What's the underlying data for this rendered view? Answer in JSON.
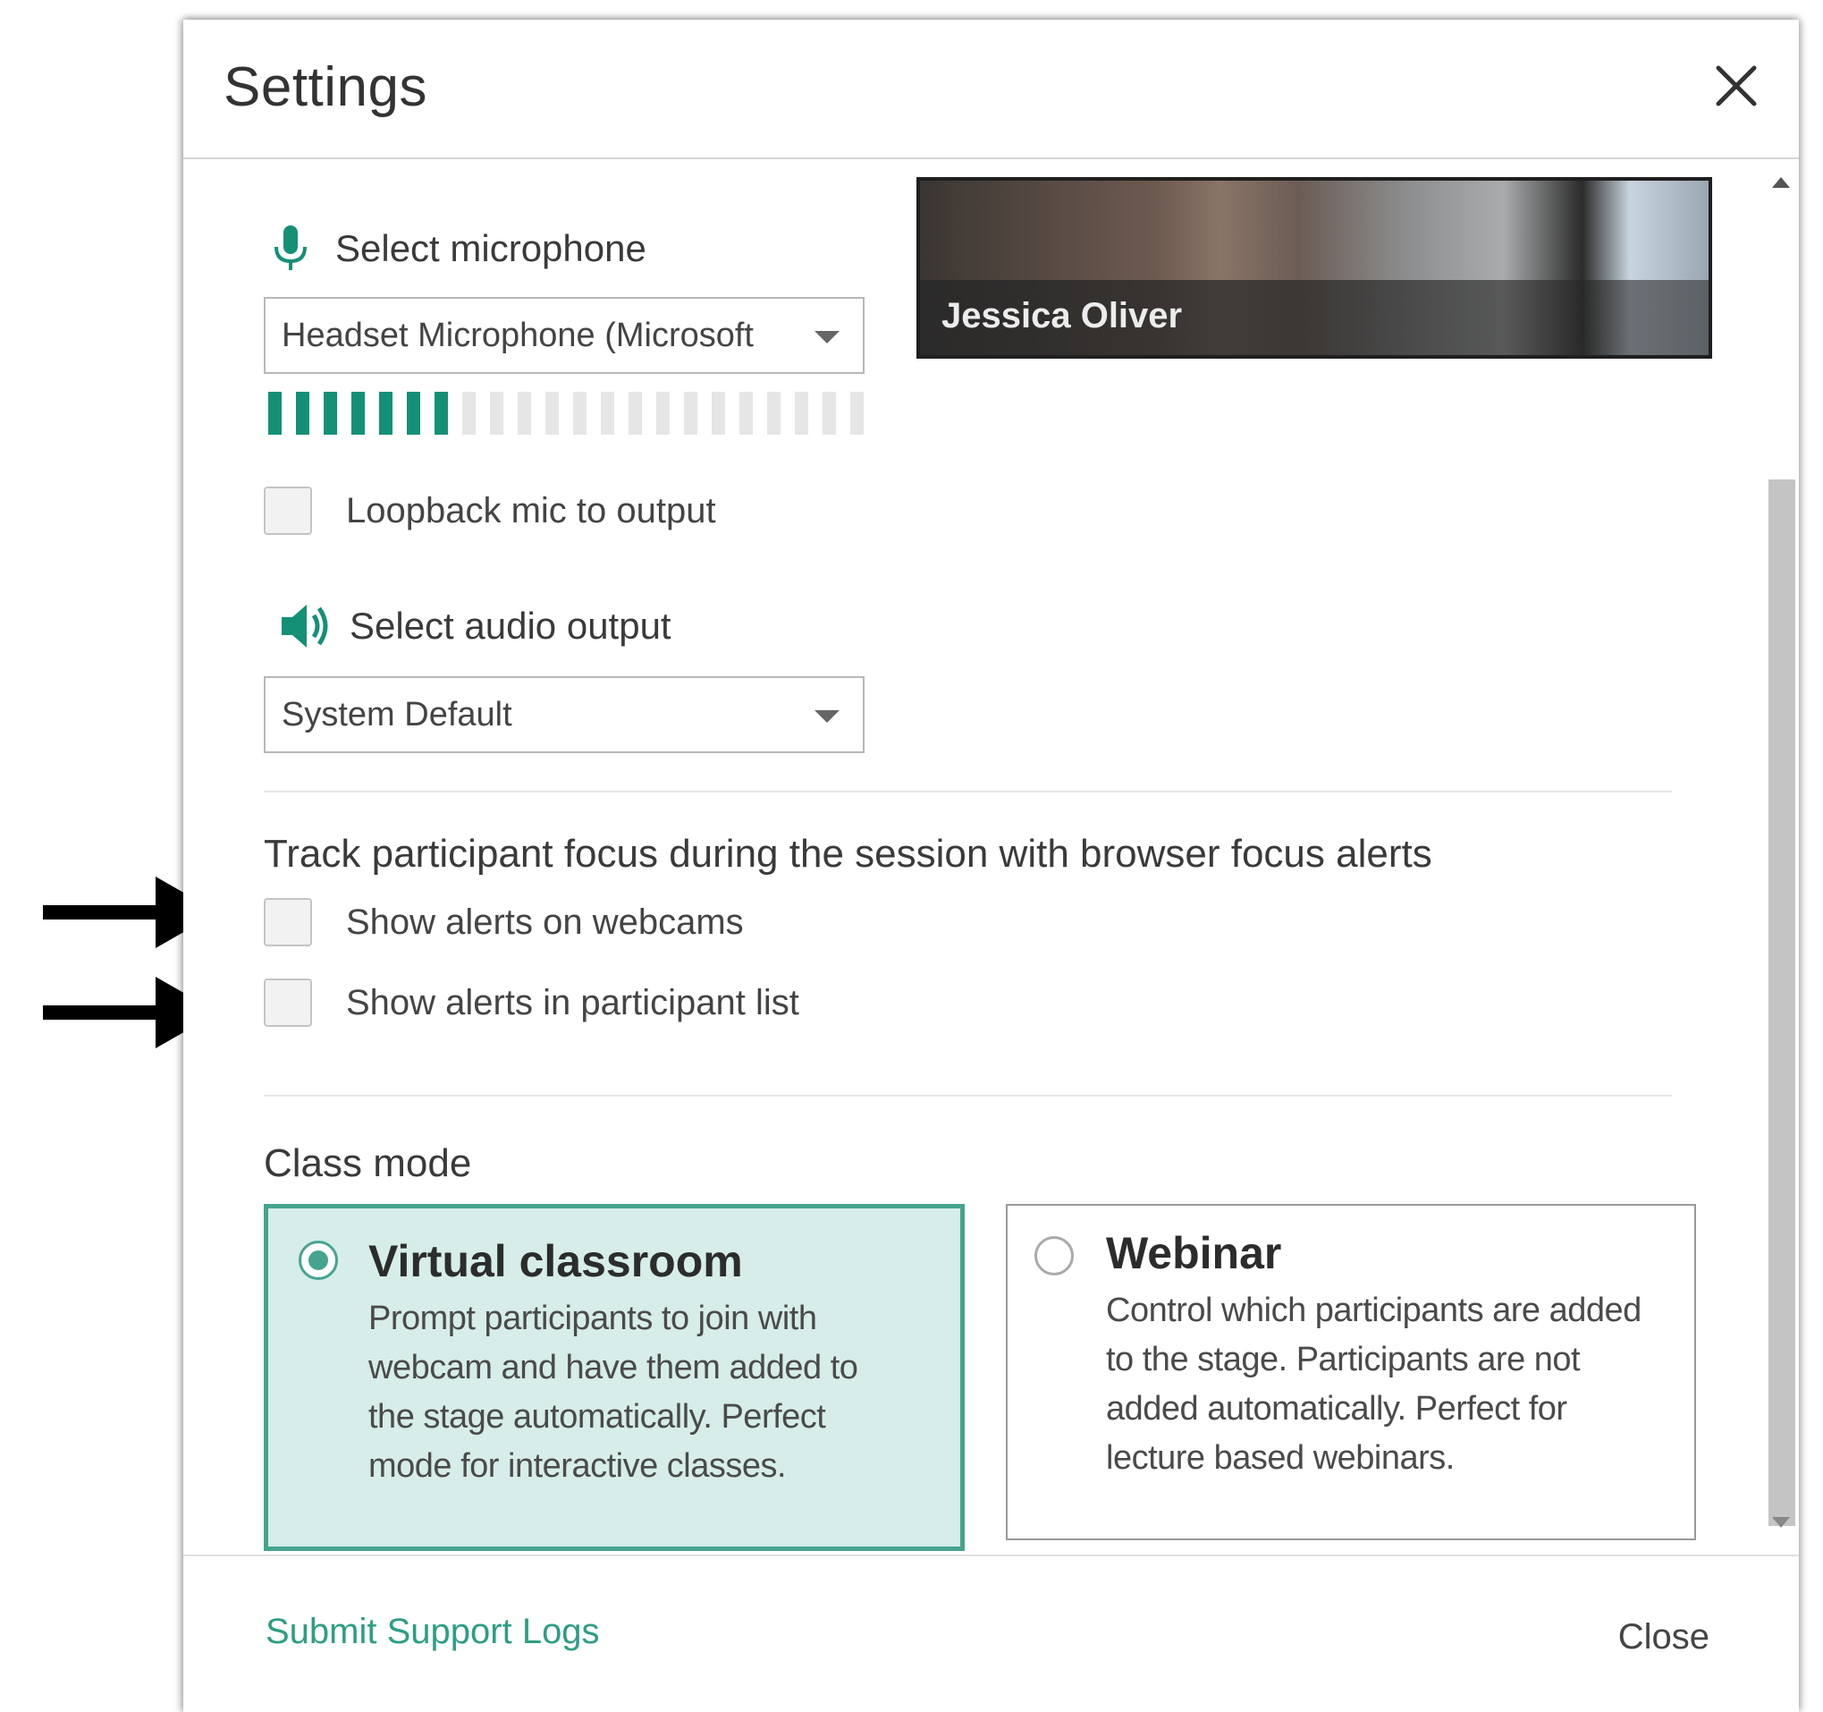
{
  "dialog": {
    "title": "Settings"
  },
  "video_preview": {
    "name": "Jessica Oliver"
  },
  "microphone": {
    "label": "Select microphone",
    "selected": "Headset Microphone (Microsoft",
    "level_active_bars": 7,
    "level_total_bars": 22,
    "accent_color": "#149077"
  },
  "loopback": {
    "label": "Loopback mic to output",
    "checked": false
  },
  "audio_output": {
    "label": "Select audio output",
    "selected": "System Default"
  },
  "focus_alerts": {
    "title": "Track participant focus during the session with browser focus alerts",
    "options": [
      {
        "label": "Show alerts on webcams",
        "checked": false
      },
      {
        "label": "Show alerts in participant list",
        "checked": false
      }
    ]
  },
  "class_mode": {
    "title": "Class mode",
    "modes": [
      {
        "title": "Virtual classroom",
        "description": "Prompt participants to join with webcam and have them added to the stage automatically. Perfect mode for interactive classes.",
        "selected": true
      },
      {
        "title": "Webinar",
        "description": "Control which participants are added to the stage. Participants are not added automatically. Perfect for lecture based webinars.",
        "selected": false
      }
    ]
  },
  "footer": {
    "support_link": "Submit Support Logs",
    "close_label": "Close"
  }
}
